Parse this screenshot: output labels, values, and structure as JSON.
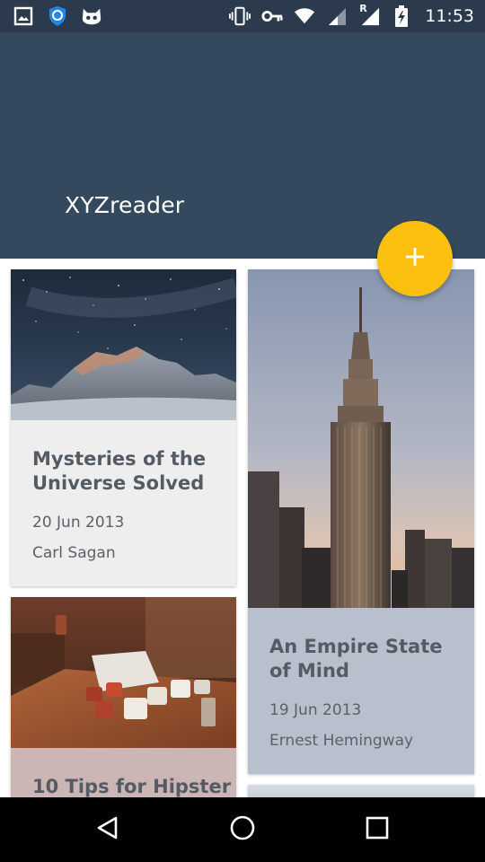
{
  "status_bar": {
    "time": "11:53",
    "icons": [
      "image-icon",
      "shield-icon",
      "cat-icon",
      "vibrate-icon",
      "key-icon",
      "wifi-icon",
      "signal-icon",
      "signal-roaming-icon",
      "battery-charging-icon"
    ],
    "roaming_label": "R"
  },
  "app_bar": {
    "title": "XYZreader",
    "color": "#34495e",
    "fab_icon": "plus-icon",
    "fab_color": "#fbbf10"
  },
  "articles": [
    {
      "title": "Mysteries of the Universe Solved",
      "date": "20 Jun 2013",
      "author": "Carl Sagan",
      "image": "mountain-night-sky"
    },
    {
      "title": "An Empire State of Mind",
      "date": "19 Jun 2013",
      "author": "Ernest Hemingway",
      "image": "empire-state-building"
    },
    {
      "title": "10 Tips for Hipster",
      "date": "",
      "author": "",
      "image": "cups-on-table"
    }
  ],
  "nav_bar": {
    "icons": [
      "back-icon",
      "home-icon",
      "recents-icon"
    ]
  }
}
